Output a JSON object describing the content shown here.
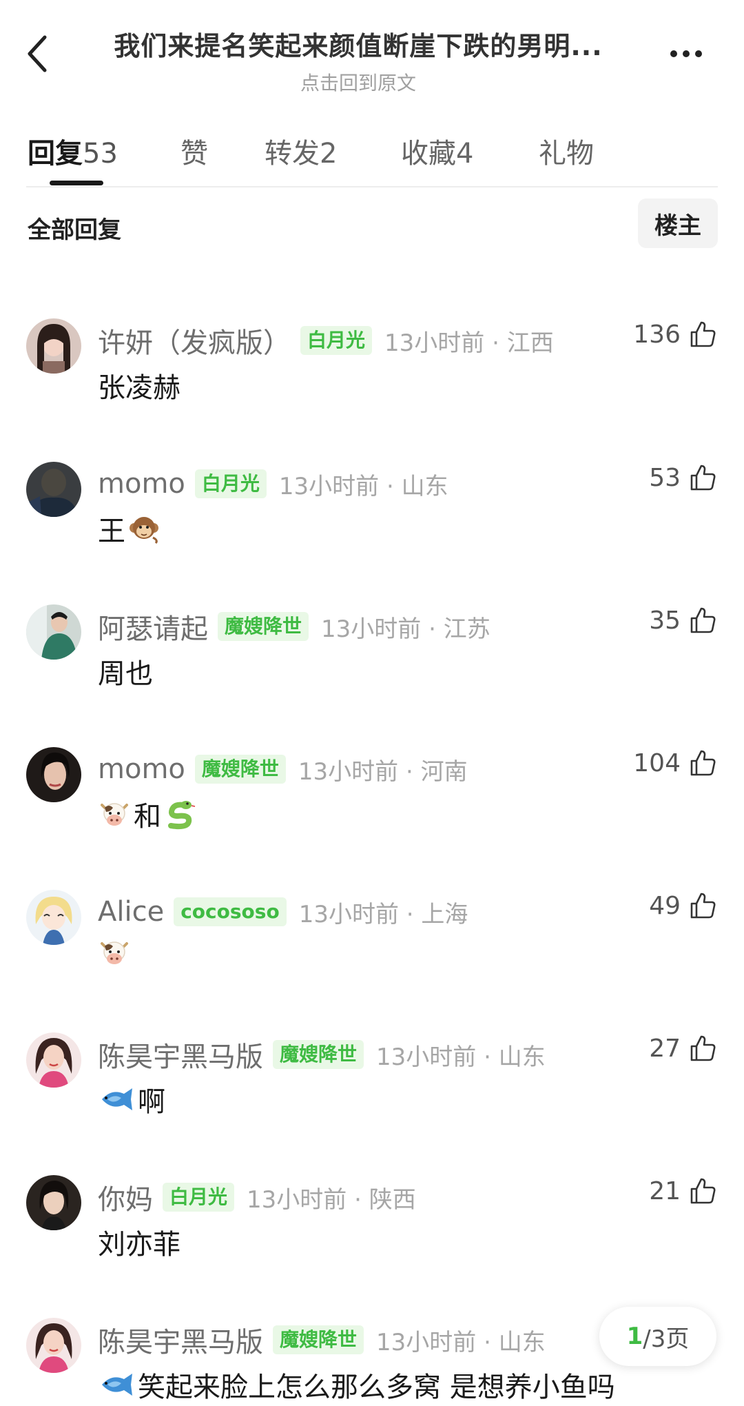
{
  "header": {
    "title": "我们来提名笑起来颜值断崖下跌的男明...",
    "subtitle": "点击回到原文"
  },
  "tabs": [
    {
      "label": "回复",
      "count": "53"
    },
    {
      "label": "赞",
      "count": ""
    },
    {
      "label": "转发",
      "count": "2"
    },
    {
      "label": "收藏",
      "count": "4"
    },
    {
      "label": "礼物",
      "count": ""
    }
  ],
  "filter": {
    "label": "全部回复",
    "owner_button": "楼主"
  },
  "comments": [
    {
      "name": "许妍（发疯版）",
      "badge": "白月光",
      "time": "13小时前",
      "location": "江西",
      "likes": "136",
      "text": "张凌赫",
      "emoji": []
    },
    {
      "name": "momo",
      "badge": "白月光",
      "time": "13小时前",
      "location": "山东",
      "likes": "53",
      "text": "王",
      "emoji": [
        "monkey"
      ]
    },
    {
      "name": "阿瑟请起",
      "badge": "魔嫂降世",
      "time": "13小时前",
      "location": "江苏",
      "likes": "35",
      "text": "周也",
      "emoji": []
    },
    {
      "name": "momo",
      "badge": "魔嫂降世",
      "time": "13小时前",
      "location": "河南",
      "likes": "104",
      "text": "和",
      "emoji": [
        "cow",
        "snake"
      ]
    },
    {
      "name": "Alice",
      "badge": "cocososo",
      "time": "13小时前",
      "location": "上海",
      "likes": "49",
      "text": "",
      "emoji": [
        "cow"
      ]
    },
    {
      "name": "陈昊宇黑马版",
      "badge": "魔嫂降世",
      "time": "13小时前",
      "location": "山东",
      "likes": "27",
      "text": "啊",
      "emoji": [
        "fish"
      ]
    },
    {
      "name": "你妈",
      "badge": "白月光",
      "time": "13小时前",
      "location": "陕西",
      "likes": "21",
      "text": "刘亦菲",
      "emoji": []
    },
    {
      "name": "陈昊宇黑马版",
      "badge": "魔嫂降世",
      "time": "13小时前",
      "location": "山东",
      "likes": "",
      "text": "笑起来脸上怎么那么多窝 是想养小鱼吗",
      "emoji": [
        "fish"
      ]
    }
  ],
  "pager": {
    "current": "1",
    "total_text": "/3页"
  },
  "colors": {
    "badge_green": "#3fbb43",
    "badge_bg": "#e9f8e6",
    "meta_gray": "#a6a6a6"
  }
}
